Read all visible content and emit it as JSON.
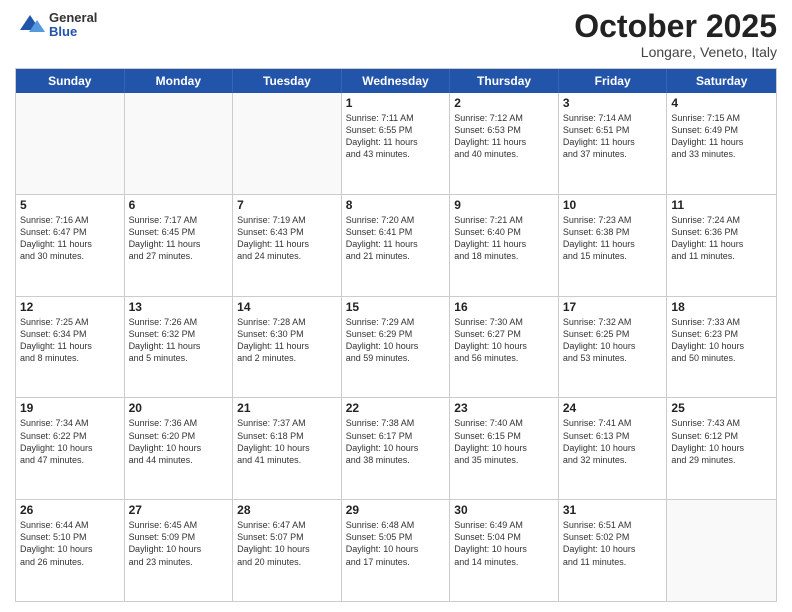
{
  "header": {
    "logo": {
      "general": "General",
      "blue": "Blue"
    },
    "month": "October 2025",
    "location": "Longare, Veneto, Italy"
  },
  "days_of_week": [
    "Sunday",
    "Monday",
    "Tuesday",
    "Wednesday",
    "Thursday",
    "Friday",
    "Saturday"
  ],
  "weeks": [
    [
      {
        "day": "",
        "info": ""
      },
      {
        "day": "",
        "info": ""
      },
      {
        "day": "",
        "info": ""
      },
      {
        "day": "1",
        "info": "Sunrise: 7:11 AM\nSunset: 6:55 PM\nDaylight: 11 hours\nand 43 minutes."
      },
      {
        "day": "2",
        "info": "Sunrise: 7:12 AM\nSunset: 6:53 PM\nDaylight: 11 hours\nand 40 minutes."
      },
      {
        "day": "3",
        "info": "Sunrise: 7:14 AM\nSunset: 6:51 PM\nDaylight: 11 hours\nand 37 minutes."
      },
      {
        "day": "4",
        "info": "Sunrise: 7:15 AM\nSunset: 6:49 PM\nDaylight: 11 hours\nand 33 minutes."
      }
    ],
    [
      {
        "day": "5",
        "info": "Sunrise: 7:16 AM\nSunset: 6:47 PM\nDaylight: 11 hours\nand 30 minutes."
      },
      {
        "day": "6",
        "info": "Sunrise: 7:17 AM\nSunset: 6:45 PM\nDaylight: 11 hours\nand 27 minutes."
      },
      {
        "day": "7",
        "info": "Sunrise: 7:19 AM\nSunset: 6:43 PM\nDaylight: 11 hours\nand 24 minutes."
      },
      {
        "day": "8",
        "info": "Sunrise: 7:20 AM\nSunset: 6:41 PM\nDaylight: 11 hours\nand 21 minutes."
      },
      {
        "day": "9",
        "info": "Sunrise: 7:21 AM\nSunset: 6:40 PM\nDaylight: 11 hours\nand 18 minutes."
      },
      {
        "day": "10",
        "info": "Sunrise: 7:23 AM\nSunset: 6:38 PM\nDaylight: 11 hours\nand 15 minutes."
      },
      {
        "day": "11",
        "info": "Sunrise: 7:24 AM\nSunset: 6:36 PM\nDaylight: 11 hours\nand 11 minutes."
      }
    ],
    [
      {
        "day": "12",
        "info": "Sunrise: 7:25 AM\nSunset: 6:34 PM\nDaylight: 11 hours\nand 8 minutes."
      },
      {
        "day": "13",
        "info": "Sunrise: 7:26 AM\nSunset: 6:32 PM\nDaylight: 11 hours\nand 5 minutes."
      },
      {
        "day": "14",
        "info": "Sunrise: 7:28 AM\nSunset: 6:30 PM\nDaylight: 11 hours\nand 2 minutes."
      },
      {
        "day": "15",
        "info": "Sunrise: 7:29 AM\nSunset: 6:29 PM\nDaylight: 10 hours\nand 59 minutes."
      },
      {
        "day": "16",
        "info": "Sunrise: 7:30 AM\nSunset: 6:27 PM\nDaylight: 10 hours\nand 56 minutes."
      },
      {
        "day": "17",
        "info": "Sunrise: 7:32 AM\nSunset: 6:25 PM\nDaylight: 10 hours\nand 53 minutes."
      },
      {
        "day": "18",
        "info": "Sunrise: 7:33 AM\nSunset: 6:23 PM\nDaylight: 10 hours\nand 50 minutes."
      }
    ],
    [
      {
        "day": "19",
        "info": "Sunrise: 7:34 AM\nSunset: 6:22 PM\nDaylight: 10 hours\nand 47 minutes."
      },
      {
        "day": "20",
        "info": "Sunrise: 7:36 AM\nSunset: 6:20 PM\nDaylight: 10 hours\nand 44 minutes."
      },
      {
        "day": "21",
        "info": "Sunrise: 7:37 AM\nSunset: 6:18 PM\nDaylight: 10 hours\nand 41 minutes."
      },
      {
        "day": "22",
        "info": "Sunrise: 7:38 AM\nSunset: 6:17 PM\nDaylight: 10 hours\nand 38 minutes."
      },
      {
        "day": "23",
        "info": "Sunrise: 7:40 AM\nSunset: 6:15 PM\nDaylight: 10 hours\nand 35 minutes."
      },
      {
        "day": "24",
        "info": "Sunrise: 7:41 AM\nSunset: 6:13 PM\nDaylight: 10 hours\nand 32 minutes."
      },
      {
        "day": "25",
        "info": "Sunrise: 7:43 AM\nSunset: 6:12 PM\nDaylight: 10 hours\nand 29 minutes."
      }
    ],
    [
      {
        "day": "26",
        "info": "Sunrise: 6:44 AM\nSunset: 5:10 PM\nDaylight: 10 hours\nand 26 minutes."
      },
      {
        "day": "27",
        "info": "Sunrise: 6:45 AM\nSunset: 5:09 PM\nDaylight: 10 hours\nand 23 minutes."
      },
      {
        "day": "28",
        "info": "Sunrise: 6:47 AM\nSunset: 5:07 PM\nDaylight: 10 hours\nand 20 minutes."
      },
      {
        "day": "29",
        "info": "Sunrise: 6:48 AM\nSunset: 5:05 PM\nDaylight: 10 hours\nand 17 minutes."
      },
      {
        "day": "30",
        "info": "Sunrise: 6:49 AM\nSunset: 5:04 PM\nDaylight: 10 hours\nand 14 minutes."
      },
      {
        "day": "31",
        "info": "Sunrise: 6:51 AM\nSunset: 5:02 PM\nDaylight: 10 hours\nand 11 minutes."
      },
      {
        "day": "",
        "info": ""
      }
    ]
  ]
}
